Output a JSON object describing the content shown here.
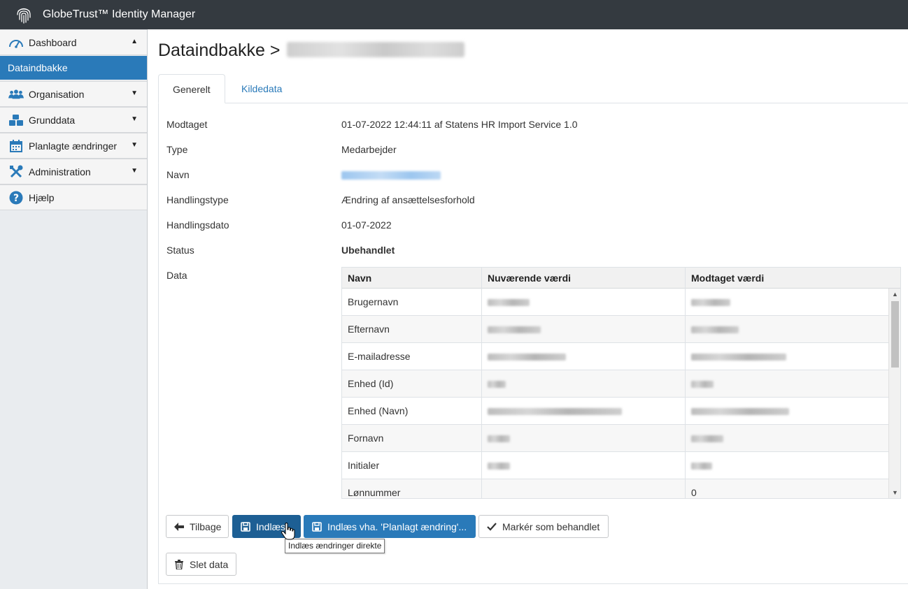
{
  "app": {
    "title": "GlobeTrust™ Identity Manager"
  },
  "sidebar": {
    "items": [
      {
        "label": "Dashboard",
        "icon": "speedometer-icon"
      },
      {
        "label": "Dataindbakke"
      },
      {
        "label": "Organisation",
        "icon": "users-icon"
      },
      {
        "label": "Grunddata",
        "icon": "cubes-icon"
      },
      {
        "label": "Planlagte ændringer",
        "icon": "calendar-icon"
      },
      {
        "label": "Administration",
        "icon": "tools-icon"
      },
      {
        "label": "Hjælp",
        "icon": "question-icon"
      }
    ]
  },
  "page": {
    "title": "Dataindbakke >"
  },
  "tabs": [
    {
      "label": "Generelt"
    },
    {
      "label": "Kildedata"
    }
  ],
  "fields": [
    {
      "label": "Modtaget",
      "value": "01-07-2022 12:44:11 af Statens HR Import Service 1.0"
    },
    {
      "label": "Type",
      "value": "Medarbejder"
    },
    {
      "label": "Navn",
      "value": ""
    },
    {
      "label": "Handlingstype",
      "value": "Ændring af ansættelsesforhold"
    },
    {
      "label": "Handlingsdato",
      "value": "01-07-2022"
    },
    {
      "label": "Status",
      "value": "Ubehandlet"
    },
    {
      "label": "Data",
      "value": ""
    }
  ],
  "table": {
    "headers": [
      "Navn",
      "Nuværende værdi",
      "Modtaget værdi"
    ],
    "rows": [
      {
        "name": "Brugernavn",
        "current": "",
        "received": ""
      },
      {
        "name": "Efternavn",
        "current": "",
        "received": ""
      },
      {
        "name": "E-mailadresse",
        "current": "",
        "received": ""
      },
      {
        "name": "Enhed (Id)",
        "current": "",
        "received": ""
      },
      {
        "name": "Enhed (Navn)",
        "current": "",
        "received": ""
      },
      {
        "name": "Fornavn",
        "current": "",
        "received": ""
      },
      {
        "name": "Initialer",
        "current": "",
        "received": ""
      },
      {
        "name": "Lønnummer",
        "current": "",
        "received": "0"
      }
    ]
  },
  "buttons": {
    "back": "Tilbage",
    "import": "Indlæs",
    "import_planned": "Indlæs vha. 'Planlagt ændring'...",
    "mark_handled": "Markér som behandlet",
    "delete": "Slet data"
  },
  "tooltip": "Indlæs ændringer direkte",
  "colors": {
    "topbar": "#343a40",
    "accent": "#2a7ab9",
    "link": "#2a7ab9"
  }
}
